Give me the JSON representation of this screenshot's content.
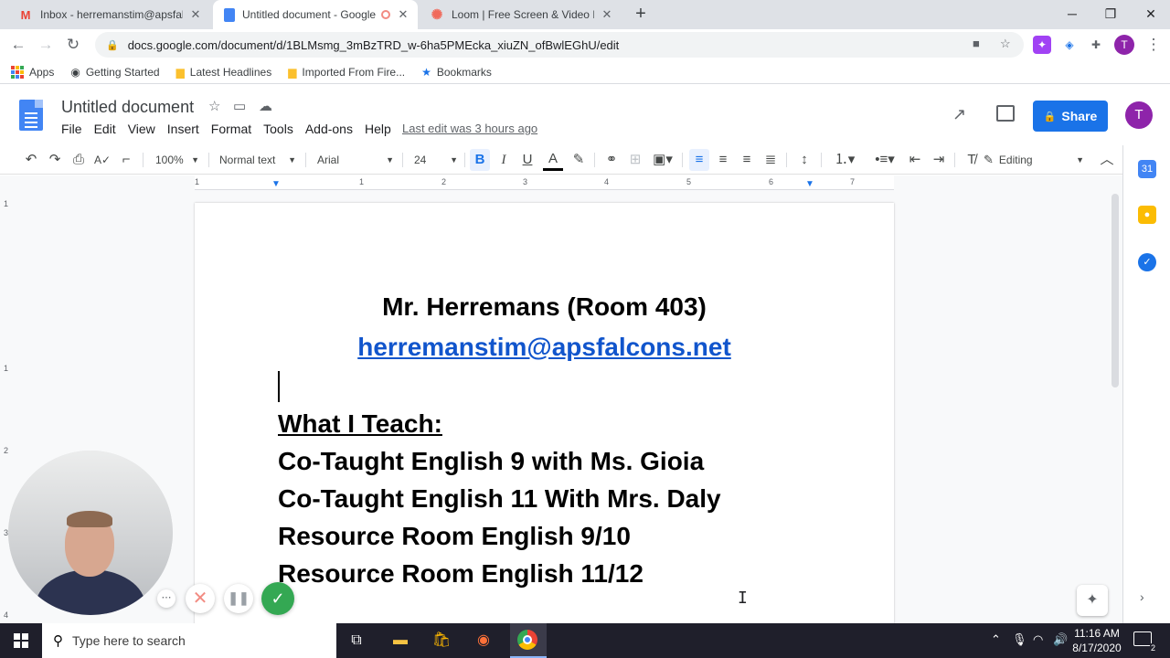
{
  "browser": {
    "tabs": [
      {
        "favicon": "gmail-icon",
        "title": "Inbox - herremanstim@apsfalcons.net",
        "active": false
      },
      {
        "favicon": "docs-icon",
        "title": "Untitled document - Google Docs",
        "active": true
      },
      {
        "favicon": "loom-icon",
        "title": "Loom | Free Screen & Video Recording",
        "active": false
      }
    ],
    "url": "docs.google.com/document/d/1BLMsmg_3mBzTRD_w-6ha5PMEcka_xiuZN_ofBwlEGhU/edit",
    "profile_initial": "T",
    "bookmarks": [
      {
        "icon": "apps-grid-icon",
        "label": "Apps"
      },
      {
        "icon": "globe-icon",
        "label": "Getting Started"
      },
      {
        "icon": "folder-icon",
        "label": "Latest Headlines"
      },
      {
        "icon": "folder-icon",
        "label": "Imported From Fire..."
      },
      {
        "icon": "star-icon",
        "label": "Bookmarks"
      }
    ]
  },
  "docs": {
    "title": "Untitled document",
    "menu": [
      "File",
      "Edit",
      "View",
      "Insert",
      "Format",
      "Tools",
      "Add-ons",
      "Help"
    ],
    "last_edit": "Last edit was 3 hours ago",
    "share_label": "Share",
    "account_initial": "T",
    "toolbar": {
      "zoom": "100%",
      "style": "Normal text",
      "font": "Arial",
      "size": "24",
      "bold": "B",
      "italic": "I",
      "underline": "U",
      "text_color": "A",
      "mode": "Editing"
    },
    "ruler_numbers": [
      "1",
      "1",
      "2",
      "3",
      "4",
      "5",
      "6",
      "7"
    ],
    "vruler_numbers": [
      "1",
      "1",
      "2",
      "3",
      "4"
    ]
  },
  "document": {
    "heading": "Mr. Herremans (Room 403)",
    "email": "herremanstim@apsfalcons.net",
    "section_title": "What I Teach:",
    "classes": [
      "Co-Taught English 9 with Ms. Gioia",
      "Co-Taught English 11 With Mrs. Daly",
      "Resource Room English 9/10",
      "Resource Room English 11/12"
    ]
  },
  "taskbar": {
    "search_placeholder": "Type here to search",
    "time": "11:16 AM",
    "date": "8/17/2020",
    "notification_count": "2"
  },
  "colors": {
    "share": "#1a73e8",
    "link": "#1155cc",
    "avatar": "#8e24aa",
    "loom_done": "#34a853"
  }
}
